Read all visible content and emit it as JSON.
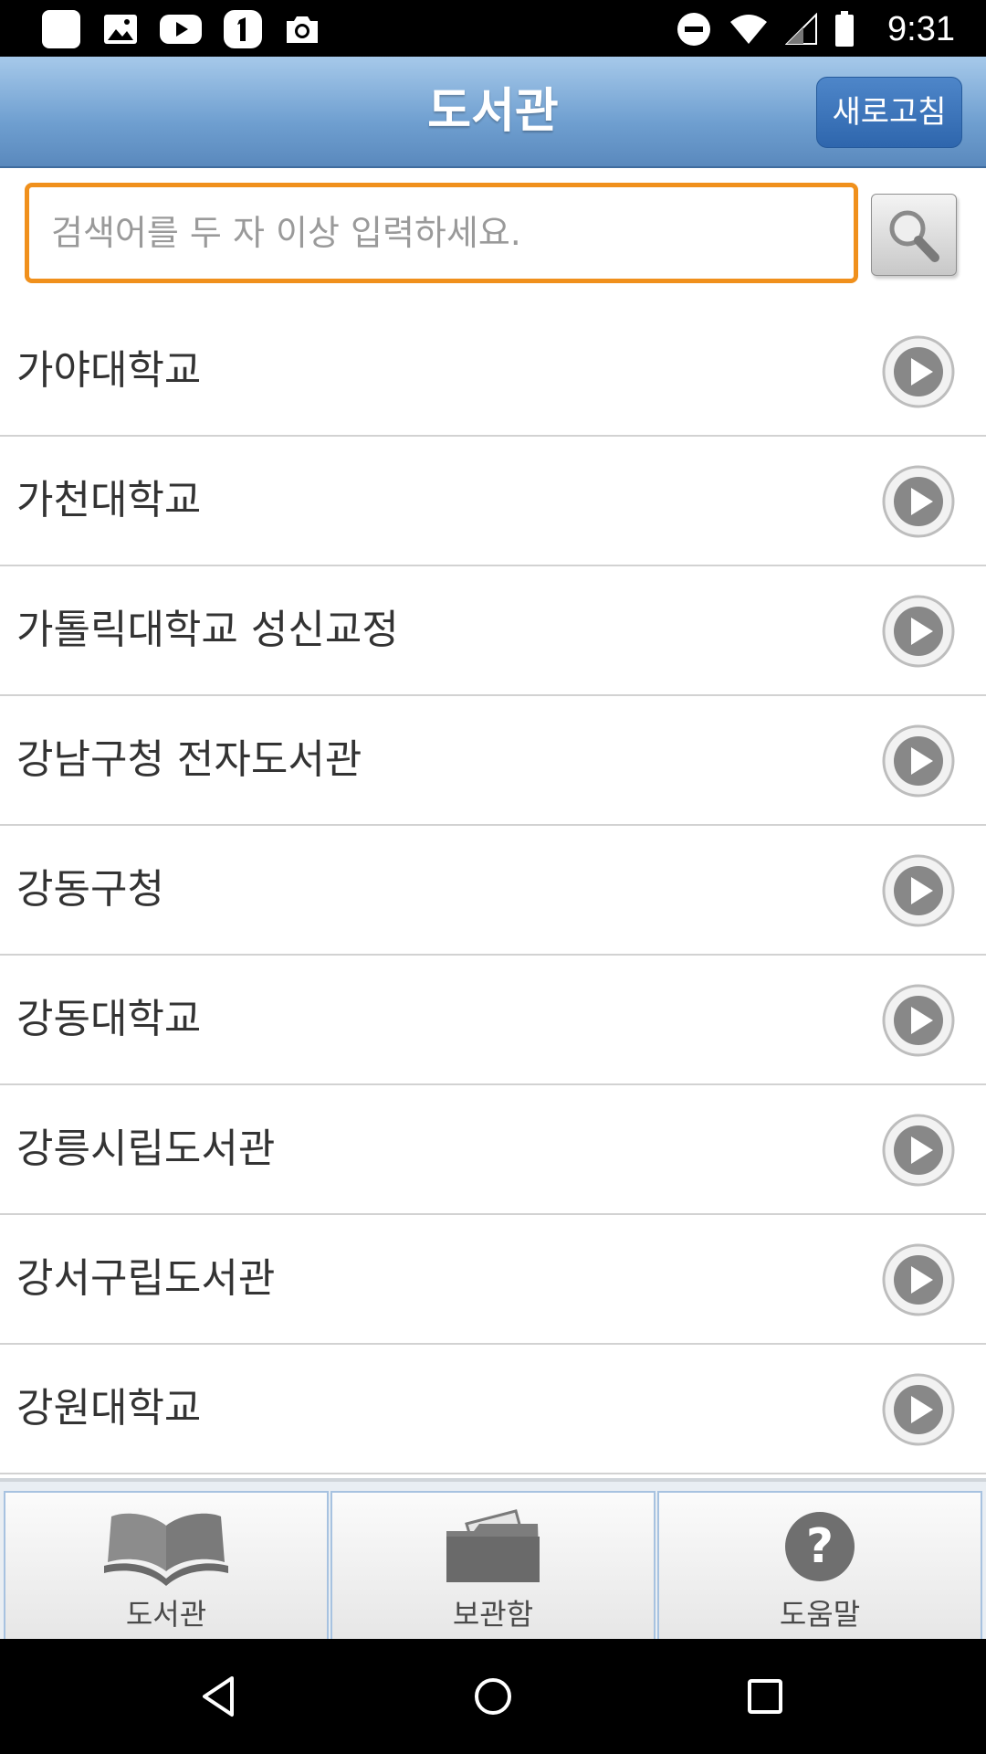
{
  "status_bar": {
    "time": "9:31",
    "left_icons": [
      "notification-square-icon",
      "image-icon",
      "youtube-icon",
      "one-app-icon",
      "camera-icon"
    ],
    "right_icons": [
      "do-not-disturb-icon",
      "wifi-icon",
      "signal-icon",
      "battery-icon"
    ]
  },
  "header": {
    "title": "도서관",
    "refresh_label": "새로고침"
  },
  "search": {
    "placeholder": "검색어를 두 자 이상 입력하세요.",
    "value": ""
  },
  "libraries": [
    {
      "name": "가야대학교"
    },
    {
      "name": "가천대학교"
    },
    {
      "name": "가톨릭대학교 성신교정"
    },
    {
      "name": "강남구청 전자도서관"
    },
    {
      "name": "강동구청"
    },
    {
      "name": "강동대학교"
    },
    {
      "name": "강릉시립도서관"
    },
    {
      "name": "강서구립도서관"
    },
    {
      "name": "강원대학교"
    }
  ],
  "tabs": [
    {
      "label": "도서관",
      "icon": "open-book-icon"
    },
    {
      "label": "보관함",
      "icon": "folder-icon"
    },
    {
      "label": "도움말",
      "icon": "help-icon"
    }
  ],
  "colors": {
    "header_blue": "#6f9fd0",
    "refresh_blue": "#2e66ad",
    "search_border": "#f0901c"
  }
}
